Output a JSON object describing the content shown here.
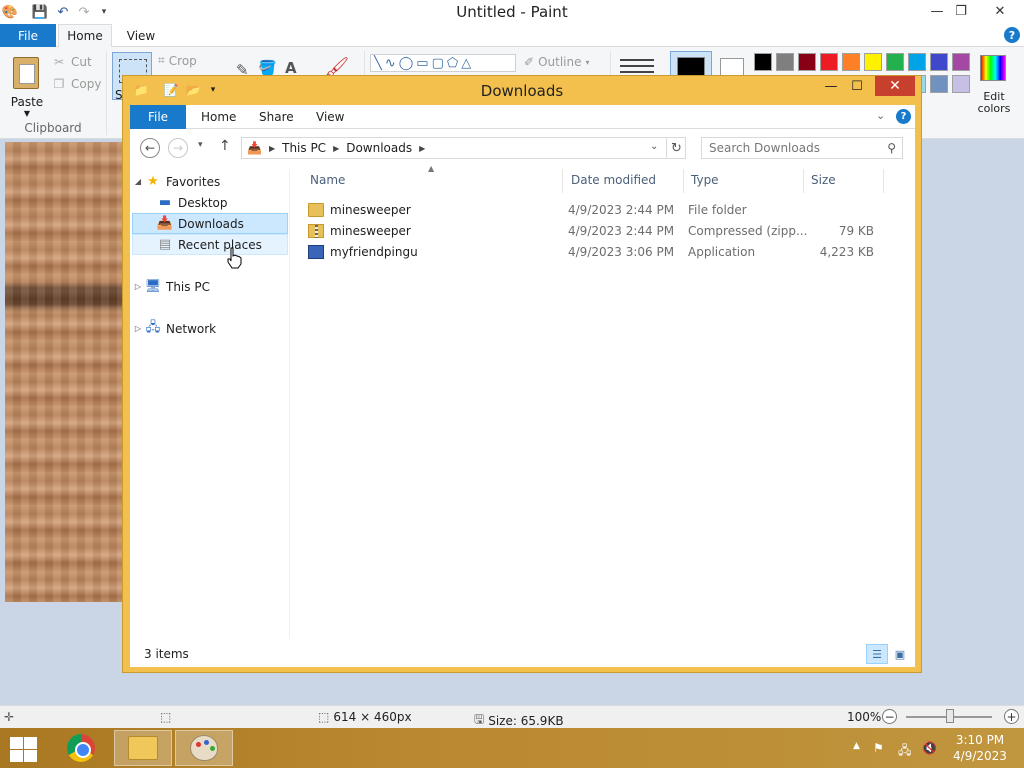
{
  "paint": {
    "title": "Untitled - Paint",
    "tabs": {
      "file": "File",
      "home": "Home",
      "view": "View"
    },
    "help": "?",
    "clipboard": {
      "paste": "Paste",
      "cut": "Cut",
      "copy": "Copy",
      "group_label": "Clipboard"
    },
    "image": {
      "crop": "Crop",
      "select_partial": "S"
    },
    "shapes": {
      "outline": "Outline"
    },
    "colors": {
      "color1": "#000000",
      "color2": "#ffffff",
      "palette_row1": [
        "#000000",
        "#7f7f7f",
        "#880015",
        "#ed1c24",
        "#ff7f27",
        "#fff200",
        "#22b14c",
        "#00a2e8",
        "#3f48cc",
        "#a349a4"
      ],
      "palette_row2": [
        "#ffffff",
        "#c3c3c3",
        "#b97a57",
        "#ffaec9",
        "#ffc90e",
        "#efe4b0",
        "#b5e61d",
        "#99d9ea",
        "#7092be",
        "#c8bfe7"
      ],
      "edit_colors_line1": "Edit",
      "edit_colors_line2": "colors"
    },
    "status": {
      "dimensions": "614 × 460px",
      "size": "Size: 65.9KB",
      "zoom": "100%"
    }
  },
  "explorer": {
    "title": "Downloads",
    "tabs": {
      "file": "File",
      "home": "Home",
      "share": "Share",
      "view": "View"
    },
    "help": "?",
    "breadcrumb": [
      "This PC",
      "Downloads"
    ],
    "search_placeholder": "Search Downloads",
    "nav": {
      "favorites": "Favorites",
      "desktop": "Desktop",
      "downloads": "Downloads",
      "recent_places": "Recent places",
      "this_pc": "This PC",
      "network": "Network"
    },
    "columns": {
      "name": "Name",
      "date_modified": "Date modified",
      "type": "Type",
      "size": "Size"
    },
    "files": [
      {
        "name": "minesweeper",
        "date": "4/9/2023 2:44 PM",
        "type": "File folder",
        "size": "",
        "icon": "folder-icon"
      },
      {
        "name": "minesweeper",
        "date": "4/9/2023 2:44 PM",
        "type": "Compressed (zipp...",
        "size": "79 KB",
        "icon": "zip-folder-icon"
      },
      {
        "name": "myfriendpingu",
        "date": "4/9/2023 3:06 PM",
        "type": "Application",
        "size": "4,223 KB",
        "icon": "application-icon"
      }
    ],
    "status": {
      "item_count": "3 items"
    }
  },
  "taskbar": {
    "time": "3:10 PM",
    "date": "4/9/2023"
  }
}
